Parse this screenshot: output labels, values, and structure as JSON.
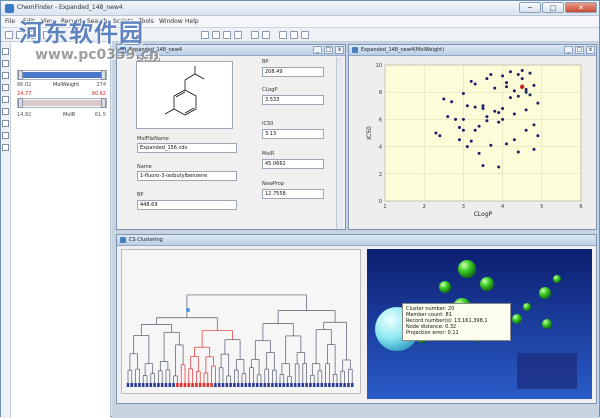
{
  "app": {
    "title": "ChemFinder - Expanded_148_new4",
    "min": "─",
    "max": "□",
    "close": "✕"
  },
  "menu": [
    "File",
    "Edit",
    "View",
    "Record",
    "Search",
    "Scripts",
    "Tools",
    "Window",
    "Help"
  ],
  "watermark": {
    "line1": "河东软件园",
    "line2": "www.pc0359.cn"
  },
  "sliders": [
    {
      "lo": "86.02",
      "hi": "274",
      "name": "MolWeight",
      "lo_red": false,
      "hi_red": false,
      "level": 1.0
    },
    {
      "lo": "24.77",
      "hi": "90.62",
      "name": "",
      "lo_red": true,
      "hi_red": true,
      "level": 1.0
    },
    {
      "lo": "14.82",
      "hi": "61.5",
      "name": "MolR",
      "lo_red": false,
      "hi_red": false,
      "level": 1.0
    }
  ],
  "form": {
    "title": "Expanded_148_new4",
    "structure_label": "Structure",
    "molfilename_label": "MolFileName",
    "molfilename": "Expanded_156.cdx",
    "name_label": "Name",
    "name": "1-fluoro-3-isobutylbenzene",
    "bp_left_label": "BP",
    "bp_left": "448.69",
    "bp_label": "BP",
    "bp": "208.49",
    "clogp_label": "CLogP",
    "clogp": "3.533",
    "ic50_label": "IC50",
    "ic50": "3.13",
    "molr_label": "MolR",
    "molr": "45.0662",
    "newprop_label": "NewProp",
    "newprop": "12.7558"
  },
  "plot_window": {
    "title": "Expanded_148_new4(MolWeight)"
  },
  "cluster_window": {
    "title": "CS Clustering"
  },
  "tooltip": {
    "l1": "Cluster number: 20",
    "l2": "Member count: 81",
    "l3": "Record number(s): 13,161,398,1",
    "l4": "Node distance: 0.32",
    "l5": "Projection error: 0.11"
  },
  "chart_data": {
    "type": "scatter",
    "xlabel": "CLogP",
    "ylabel": "IC50",
    "xlim": [
      1,
      6
    ],
    "ylim": [
      0,
      10
    ],
    "xticks": [
      "1",
      "2",
      "3",
      "4",
      "5",
      "6"
    ],
    "yticks": [
      "0",
      "2",
      "4",
      "6",
      "8",
      "10"
    ],
    "series": [
      {
        "color": "#1b1f6b",
        "x": [
          2.3,
          2.6,
          2.9,
          3.0,
          3.1,
          3.2,
          3.3,
          3.4,
          3.5,
          3.6,
          3.7,
          3.8,
          3.9,
          4.0,
          4.1,
          4.2,
          4.3,
          4.4,
          4.5,
          4.6,
          4.7,
          4.8,
          2.5,
          2.8,
          3.1,
          3.4,
          3.7,
          4.0,
          4.3,
          4.6,
          4.9,
          2.4,
          2.7,
          3.0,
          3.3,
          3.6,
          3.9,
          4.2,
          4.5,
          4.8,
          3.2,
          3.5,
          3.8,
          4.1,
          4.4,
          4.7,
          4.9,
          3.0,
          3.6,
          4.0,
          4.3,
          4.6,
          2.9,
          3.5,
          4.1,
          4.4,
          4.6,
          4.8,
          3.3,
          3.9
        ],
        "y": [
          5.0,
          6.2,
          4.5,
          7.9,
          4.0,
          8.8,
          5.2,
          3.5,
          6.8,
          9.0,
          4.1,
          8.3,
          6.5,
          9.2,
          8.7,
          9.5,
          8.1,
          9.3,
          9.6,
          8.2,
          9.4,
          8.5,
          7.5,
          6.0,
          7.0,
          5.5,
          9.3,
          6.0,
          4.5,
          8.0,
          7.2,
          4.8,
          7.3,
          5.2,
          8.6,
          6.2,
          5.8,
          7.6,
          9.0,
          5.6,
          4.4,
          7.0,
          6.6,
          4.2,
          3.6,
          7.8,
          4.8,
          6.0,
          5.9,
          6.8,
          6.4,
          5.2,
          5.4,
          2.6,
          8.4,
          7.7,
          6.7,
          3.8,
          6.9,
          2.5
        ]
      },
      {
        "color": "#d42020",
        "x": [
          4.5
        ],
        "y": [
          8.4
        ]
      }
    ]
  }
}
